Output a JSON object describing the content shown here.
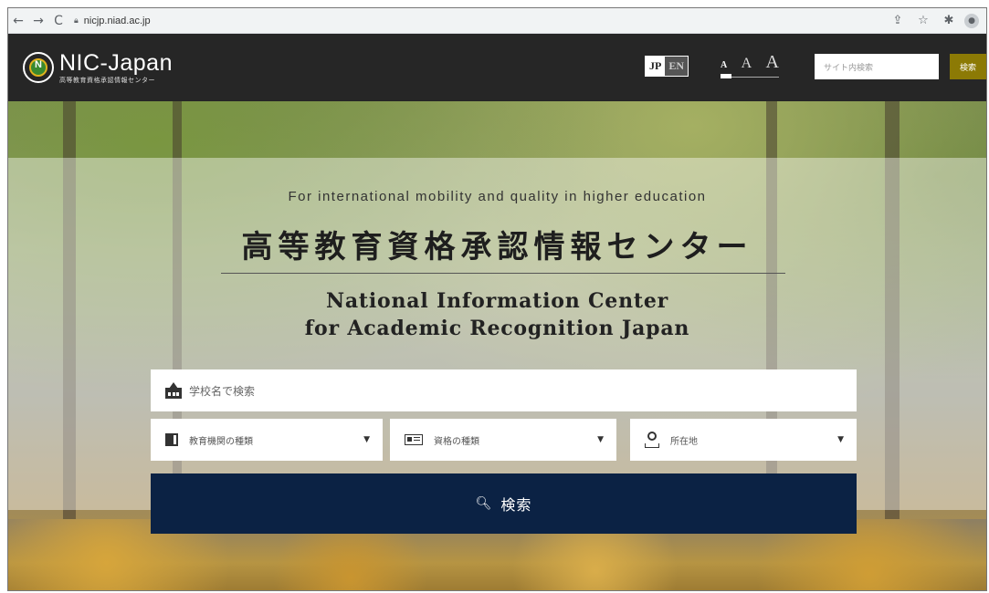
{
  "browser": {
    "back": "←",
    "forward": "→",
    "reload": "C",
    "url": "nicjp.niad.ac.jp"
  },
  "header": {
    "logo_title": "NIC-Japan",
    "logo_subtitle": "高等教育資格承認情報センター",
    "lang_jp": "JP",
    "lang_en": "EN",
    "font_small": "A",
    "font_medium": "A",
    "font_large": "A",
    "site_search_placeholder": "サイト内検索",
    "site_search_button": "検索"
  },
  "hero": {
    "tagline": "For international mobility and quality in higher education",
    "title_jp": "高等教育資格承認情報センター",
    "title_en_line1": "National Information Center",
    "title_en_line2": "for Academic Recognition Japan"
  },
  "search": {
    "school_placeholder": "学校名で検索",
    "filters": [
      {
        "label": "教育機関の種類",
        "icon": "book-icon"
      },
      {
        "label": "資格の種類",
        "icon": "id-card-icon"
      },
      {
        "label": "所在地",
        "icon": "location-pin-icon"
      }
    ],
    "button_label": "検索"
  },
  "colors": {
    "header_bg": "#262626",
    "search_button_bg": "#0b2244",
    "site_search_button_bg": "#8c7a05"
  }
}
